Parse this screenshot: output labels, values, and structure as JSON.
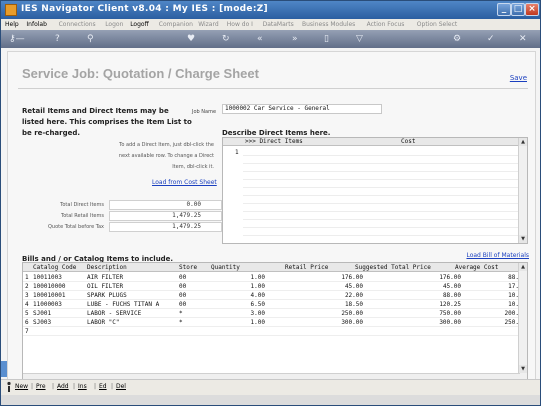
{
  "window": {
    "title": "IES Navigator Client v8.04 : My IES :    [mode:Z]"
  },
  "menu": [
    {
      "label": "Help",
      "enabled": true
    },
    {
      "label": "Infolab",
      "enabled": true
    },
    {
      "label": "Connections",
      "enabled": false
    },
    {
      "label": "Logon",
      "enabled": false
    },
    {
      "label": "Logoff",
      "enabled": true
    },
    {
      "label": "Companion",
      "enabled": false
    },
    {
      "label": "Wizard",
      "enabled": false
    },
    {
      "label": "How do I",
      "enabled": false
    },
    {
      "label": "DataMarts",
      "enabled": false
    },
    {
      "label": "Business Modules",
      "enabled": false
    },
    {
      "label": "Action Focus",
      "enabled": false
    },
    {
      "label": "Option Select",
      "enabled": false
    }
  ],
  "page": {
    "title": "Service Job: Quotation / Charge Sheet",
    "save_label": "Save",
    "intro": "Retail Items and Direct Items may be listed here. This comprises the Item List to be re-charged.",
    "job_name_label": "Job Name",
    "job_name_value": "1000002 Car Service - General",
    "hint": "To add a Direct Item, just dbl-click the next available row. To change a Direct Item, dbl-click it.",
    "load_cost_sheet": "Load from Cost Sheet",
    "totals": [
      {
        "label": "Total Direct Items",
        "value": "0.00"
      },
      {
        "label": "Total Retail Items",
        "value": "1,479.25"
      },
      {
        "label": "Quote Total before Tax",
        "value": "1,479.25"
      }
    ],
    "direct_items": {
      "header": "Describe Direct Items here.",
      "col_item": ">>> Direct Items",
      "col_cost": "Cost",
      "row_num": "1"
    },
    "bills": {
      "header": "Bills and / or Catalog Items to include.",
      "load_bom": "Load Bill of Materials",
      "columns": [
        "Catalog Code",
        "Description",
        "Store",
        "Quantity",
        "Retail Price",
        "Suggested Total Price",
        "Average Cost"
      ],
      "rows": [
        {
          "n": "1",
          "code": "10011003",
          "desc": "AIR FILTER",
          "store": "00",
          "qty": "1.00",
          "retail": "176.00",
          "total": "176.00",
          "avg": "88."
        },
        {
          "n": "2",
          "code": "100010000",
          "desc": "OIL FILTER",
          "store": "00",
          "qty": "1.00",
          "retail": "45.00",
          "total": "45.00",
          "avg": "17."
        },
        {
          "n": "3",
          "code": "100010001",
          "desc": "SPARK PLUGS",
          "store": "00",
          "qty": "4.00",
          "retail": "22.00",
          "total": "88.00",
          "avg": "10."
        },
        {
          "n": "4",
          "code": "11000003",
          "desc": "LUBE - FUCHS TITAN A",
          "store": "00",
          "qty": "6.50",
          "retail": "18.50",
          "total": "120.25",
          "avg": "10."
        },
        {
          "n": "5",
          "code": "SJ001",
          "desc": "LABOR - SERVICE",
          "store": "*",
          "qty": "3.00",
          "retail": "250.00",
          "total": "750.00",
          "avg": "200."
        },
        {
          "n": "6",
          "code": "SJ003",
          "desc": "LABOR \"C\"",
          "store": "*",
          "qty": "1.00",
          "retail": "300.00",
          "total": "300.00",
          "avg": "250."
        },
        {
          "n": "7",
          "code": "",
          "desc": "",
          "store": "",
          "qty": "",
          "retail": "",
          "total": "",
          "avg": ""
        }
      ]
    }
  },
  "bottom_bar": [
    "New",
    "Pre",
    "Add",
    "Ins",
    "Ed",
    "Del"
  ],
  "colors": {
    "title_gray": "#a4a4a4",
    "link_blue": "#1a3fbf",
    "titlebar": "#2b5ea1"
  }
}
